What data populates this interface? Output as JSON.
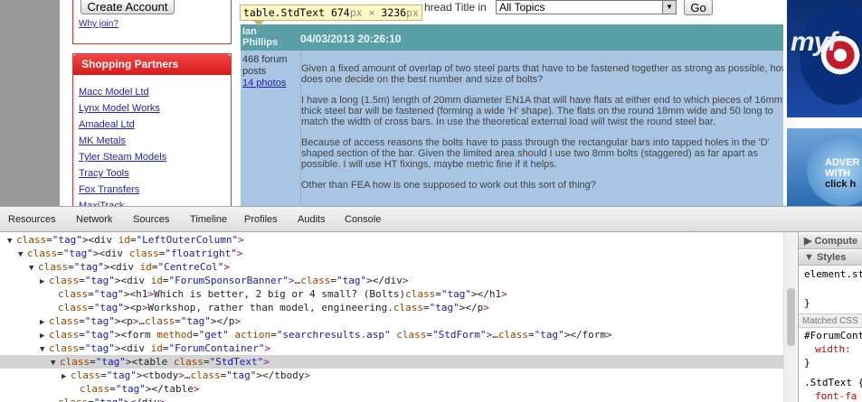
{
  "page": {
    "create_account_label": "Create Account",
    "why_join_label": "Why join?",
    "partners": {
      "title": "Shopping Partners",
      "items": [
        "Macc Model Ltd",
        "Lynx Model Works",
        "Amadeal Ltd",
        "MK Metals",
        "Tyler Steam Models",
        "Tracy Tools",
        "Fox Transfers",
        "MaxiTrack"
      ]
    },
    "search": {
      "thread_label": "hread Title in",
      "topic_value": "All Topics",
      "go_label": "Go"
    },
    "tooltip": {
      "selector": "table.StdText",
      "width": "674",
      "height": "3236",
      "unit": "px",
      "times": "×"
    },
    "post": {
      "author": "Ian Phillips",
      "date": "04/03/2013 20:26:10",
      "post_count": "468 forum posts",
      "photos_label": "14 photos",
      "paragraphs": [
        "Given a fixed amount of overlap of two steel parts that have to be fastened together as strong as possible, how does one decide on the best number and size of bolts?",
        "I have a long (1.5m) length of 20mm diameter EN1A that will have flats at either end to which pieces of 16mm thick steel bar will be fastened (forming a wide 'H' shape). The flats on the round 18mm wide and 50 long to match the width of cross bars. In use the theoretical external load will twist the round steel bar.",
        "Because of access reasons the bolts have to pass through the rectangular bars into tapped holes in the 'D' shaped section of the bar. Given the limited area should I use two 8mm bolts (staggered) as far apart as possible. I will use HT fixings, maybe metric fine if it helps.",
        "Other than FEA how is one supposed to work out this sort of thing?"
      ]
    },
    "ad": {
      "logo": "myf",
      "line1": "ADVER",
      "line2": "WITH",
      "line3": "click h"
    }
  },
  "devtools": {
    "tabs": [
      "Resources",
      "Network",
      "Sources",
      "Timeline",
      "Profiles",
      "Audits",
      "Console"
    ],
    "dom": [
      {
        "pre": "▼",
        "html": "<div id=\"LeftOuterColumn\">"
      },
      {
        "pre": "▼",
        "html": "<div class=\"floatright\">"
      },
      {
        "pre": "▼",
        "html": "<div id=\"CentreCol\">"
      },
      {
        "pre": "▶",
        "html": "<div id=\"ForumSponsorBanner\">…</div>"
      },
      {
        "pre": "",
        "html": "<h1>Which is better, 2 big or 4 small? (Bolts)</h1>"
      },
      {
        "pre": "",
        "html": "<p>Workshop, rather than model, engineering.</p>"
      },
      {
        "pre": "▶",
        "html": "<p>…</p>"
      },
      {
        "pre": "▶",
        "html": "<form method=\"get\" action=\"searchresults.asp\" class=\"StdForm\">…</form>"
      },
      {
        "pre": "▼",
        "html": "<div id=\"ForumContainer\">"
      },
      {
        "pre": "▼",
        "html": "<table class=\"StdText\">"
      },
      {
        "pre": "▶",
        "html": "<tbody>…</tbody>"
      },
      {
        "pre": "",
        "html": "</table>"
      },
      {
        "pre": "",
        "html": "</div>"
      }
    ],
    "sidebar": {
      "computed_label": "▶ Compute",
      "styles_label": "▼ Styles",
      "element_style": "element.st",
      "brace_close": "}",
      "matched_label": "Matched CSS",
      "rule1_selector": "#ForumCont",
      "rule1_prop": "width:",
      "rule2_selector": ".StdText {",
      "rule2_prop": "font-fa"
    }
  }
}
